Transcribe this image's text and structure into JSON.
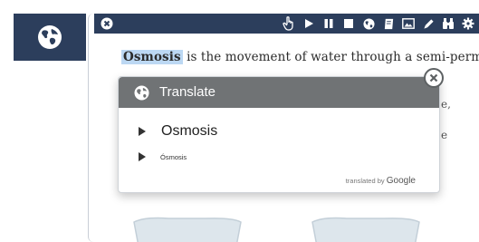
{
  "reader": {
    "passage_highlight": "Osmosis",
    "passage_rest": " is the movement of water through a semi-permeable",
    "line2_stub": "e,",
    "line3_stub": "e"
  },
  "toolbar": {
    "icons": [
      "close-icon",
      "hand-pointer-icon",
      "play-icon",
      "pause-icon",
      "stop-icon",
      "globe-icon",
      "dictionary-icon",
      "image-icon",
      "highlighter-icon",
      "binoculars-icon",
      "gear-icon"
    ]
  },
  "translate_popup": {
    "title": "Translate",
    "results": [
      {
        "text": "Osmosis"
      },
      {
        "text": "Ósmosis"
      }
    ],
    "attribution_prefix": "translated by",
    "attribution_brand": "Google"
  },
  "colors": {
    "toolbar_bg": "#2c3e5c",
    "popup_header": "#707375",
    "highlight": "#bcd8f3"
  }
}
